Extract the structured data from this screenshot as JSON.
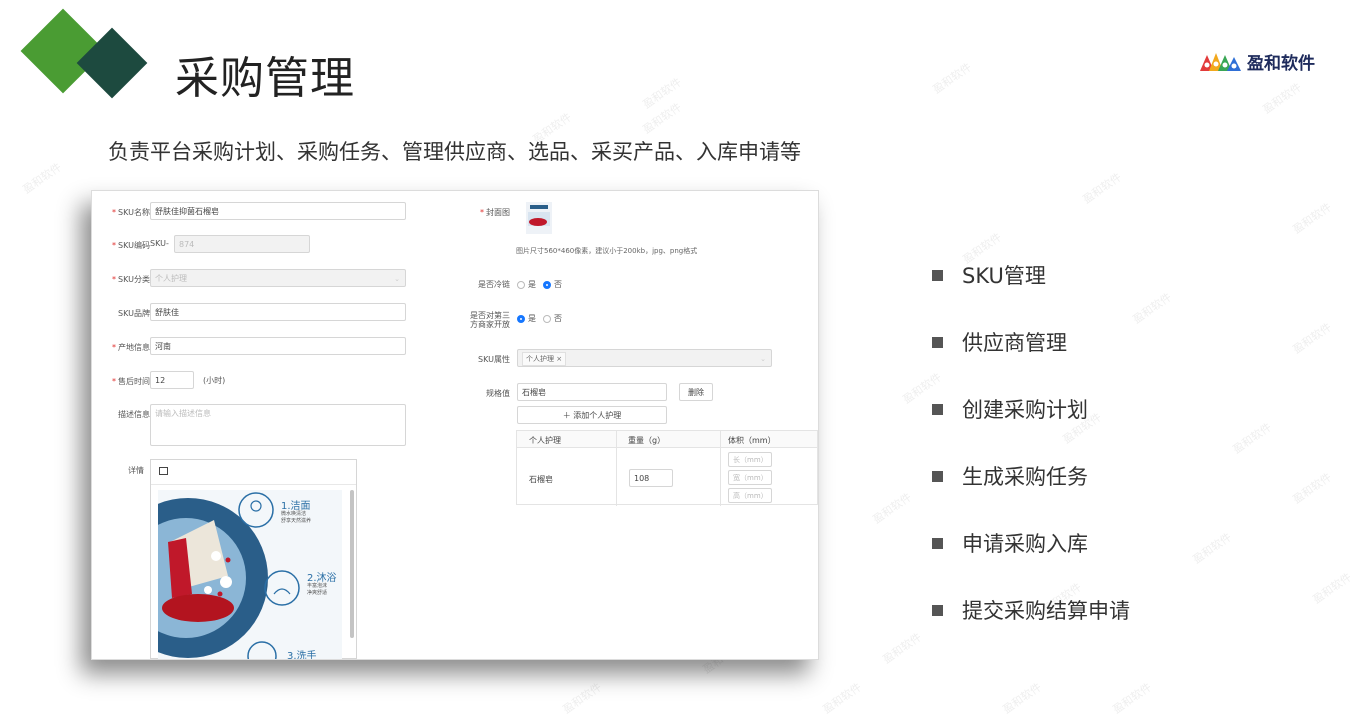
{
  "header": {
    "title": "采购管理",
    "logo_text": "盈和软件"
  },
  "subtitle": "负责平台采购计划、采购任务、管理供应商、选品、采买产品、入库申请等",
  "form": {
    "sku_name": {
      "label": "SKU名称",
      "value": "舒肤佳抑菌石榴皂"
    },
    "sku_code": {
      "label": "SKU编码",
      "prefix": "SKU-",
      "value": "874"
    },
    "sku_category": {
      "label": "SKU分类",
      "value": "个人护理"
    },
    "sku_brand": {
      "label": "SKU品牌",
      "value": "舒肤佳"
    },
    "origin": {
      "label": "产地信息",
      "value": "河南"
    },
    "after_sale": {
      "label": "售后时间",
      "value": "12",
      "unit": "(小时)"
    },
    "description": {
      "label": "描述信息",
      "placeholder": "请输入描述信息"
    },
    "detail": {
      "label": "详情",
      "steps": [
        {
          "title": "1.洁面",
          "desc1": "微水唤清洁",
          "desc2": "舒享天然滋养"
        },
        {
          "title": "2.沐浴",
          "desc1": "丰富泡沫",
          "desc2": "净爽舒适"
        },
        {
          "title": "3.洗手",
          "desc1": "",
          "desc2": ""
        }
      ]
    },
    "cover": {
      "label": "封面图",
      "hint": "图片尺寸560*460像素，建议小于200kb，jpg、png格式"
    },
    "cold_chain": {
      "label": "是否冷链",
      "opt_yes": "是",
      "opt_no": "否",
      "selected": "否"
    },
    "third_party": {
      "label1": "是否对第三",
      "label2": "方商家开放",
      "opt_yes": "是",
      "opt_no": "否",
      "selected": "是"
    },
    "sku_attr": {
      "label": "SKU属性",
      "tag": "个人护理"
    },
    "spec": {
      "label": "规格值",
      "value": "石榴皂",
      "delete_label": "删除",
      "add_label": "＋ 添加个人护理"
    },
    "table": {
      "headers": [
        "个人护理",
        "重量（g）",
        "体积（mm）"
      ],
      "row": {
        "name": "石榴皂",
        "weight": "108",
        "length_ph": "长（mm）",
        "width_ph": "宽（mm）",
        "height_ph": "高（mm）"
      }
    }
  },
  "features": [
    "SKU管理",
    "供应商管理",
    "创建采购计划",
    "生成采购任务",
    "申请采购入库",
    "提交采购结算申请"
  ],
  "watermark": "盈和软件",
  "colors": {
    "green": "#4a9c33",
    "dark_green": "#1d4a3f",
    "primary": "#1677ff",
    "required": "#e0302e"
  }
}
